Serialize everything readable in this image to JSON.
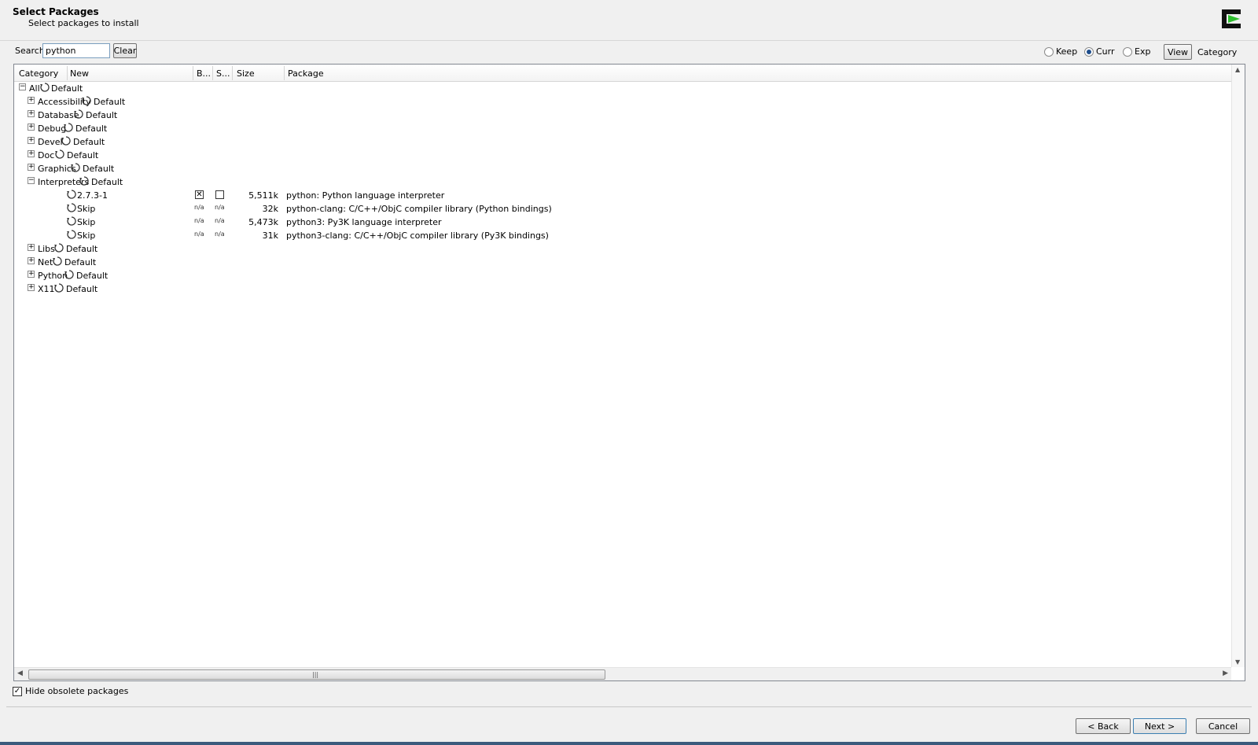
{
  "header": {
    "title": "Select Packages",
    "subtitle": "Select packages to install"
  },
  "search": {
    "label": "Search",
    "value": "python",
    "clear_label": "Clear"
  },
  "view_options": {
    "keep_label": "Keep",
    "curr_label": "Curr",
    "exp_label": "Exp",
    "selected": "Curr",
    "view_button": "View",
    "view_value": "Category"
  },
  "columns": {
    "category": "Category",
    "new": "New",
    "binary": "B...",
    "source": "S...",
    "size": "Size",
    "package": "Package"
  },
  "tree": {
    "all": {
      "name": "All",
      "action": "Default"
    },
    "categories": [
      {
        "name": "Accessibility",
        "action": "Default"
      },
      {
        "name": "Database",
        "action": "Default"
      },
      {
        "name": "Debug",
        "action": "Default"
      },
      {
        "name": "Devel",
        "action": "Default"
      },
      {
        "name": "Doc",
        "action": "Default"
      },
      {
        "name": "Graphics",
        "action": "Default"
      },
      {
        "name": "Interpreters",
        "action": "Default"
      },
      {
        "name": "Libs",
        "action": "Default"
      },
      {
        "name": "Net",
        "action": "Default"
      },
      {
        "name": "Python",
        "action": "Default"
      },
      {
        "name": "X11",
        "action": "Default"
      }
    ],
    "packages": [
      {
        "new": "2.7.3-1",
        "binary": "",
        "source": "",
        "size": "5,511k",
        "package": "python: Python language interpreter"
      },
      {
        "new": "Skip",
        "binary": "n/a",
        "source": "n/a",
        "size": "32k",
        "package": "python-clang: C/C++/ObjC compiler library (Python bindings)"
      },
      {
        "new": "Skip",
        "binary": "n/a",
        "source": "n/a",
        "size": "5,473k",
        "package": "python3: Py3K language interpreter"
      },
      {
        "new": "Skip",
        "binary": "n/a",
        "source": "n/a",
        "size": "31k",
        "package": "python3-clang: C/C++/ObjC compiler library (Py3K bindings)"
      }
    ]
  },
  "footer": {
    "hide_obsolete_label": "Hide obsolete packages",
    "hide_obsolete_checked": true,
    "back_label": "< Back",
    "next_label": "Next >",
    "cancel_label": "Cancel"
  },
  "colors": {
    "accent": "#1e4d8c",
    "logo_green": "#2fbf2f"
  }
}
